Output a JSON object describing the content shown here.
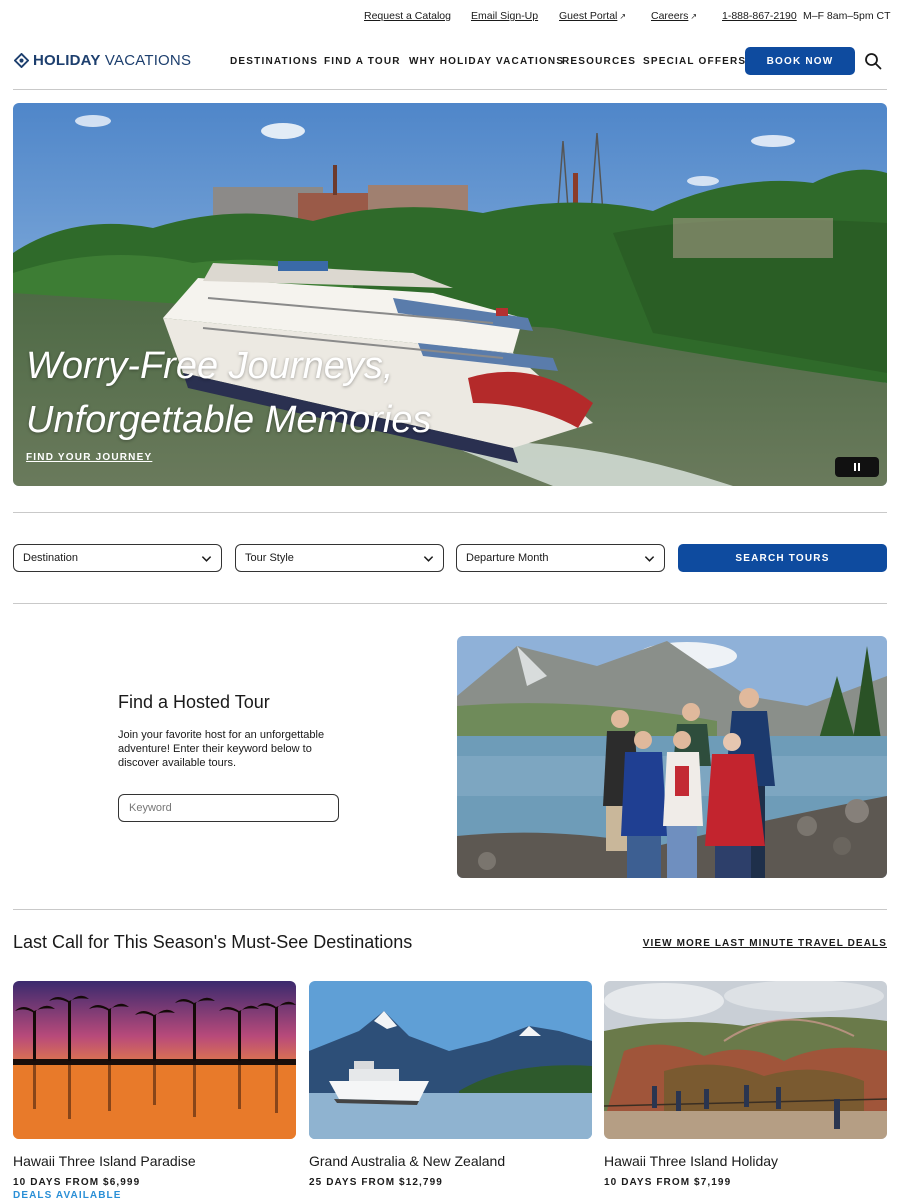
{
  "utility": {
    "catalog": "Request a Catalog",
    "email": "Email Sign-Up",
    "guest_portal": "Guest Portal",
    "careers": "Careers",
    "external_icon": "external-link-icon",
    "phone": "1-888-867-2190",
    "hours": "M–F 8am–5pm CT"
  },
  "header": {
    "logo_part1": "HOLIDAY",
    "logo_part2": "VACATIONS",
    "nav": [
      "DESTINATIONS",
      "FIND A TOUR",
      "WHY HOLIDAY VACATIONS",
      "RESOURCES",
      "SPECIAL OFFERS"
    ],
    "book_label": "BOOK NOW",
    "search_icon": "search-icon",
    "brand_color": "#0e4b9f"
  },
  "hero": {
    "line1": "Worry-Free Journeys,",
    "line2": "Unforgettable Memories",
    "cta": "FIND YOUR JOURNEY",
    "pause_icon": "pause-icon"
  },
  "search": {
    "destination": "Destination",
    "tour_style": "Tour Style",
    "departure_month": "Departure Month",
    "button": "SEARCH TOURS"
  },
  "hosted": {
    "title": "Find a Hosted Tour",
    "description": "Join your favorite host for an unforgettable adventure! Enter their keyword below to discover available tours.",
    "placeholder": "Keyword"
  },
  "deals": {
    "title": "Last Call for This Season's Must-See Destinations",
    "link": "VIEW MORE LAST MINUTE TRAVEL DEALS",
    "badge_color": "#2a8fd6",
    "cards": [
      {
        "name": "Hawaii Three Island Paradise",
        "price": "10 DAYS FROM $6,999",
        "badge": "DEALS AVAILABLE"
      },
      {
        "name": "Grand Australia & New Zealand",
        "price": "25 DAYS FROM $12,799",
        "badge": ""
      },
      {
        "name": "Hawaii Three Island Holiday",
        "price": "10 DAYS FROM $7,199",
        "badge": ""
      }
    ]
  }
}
